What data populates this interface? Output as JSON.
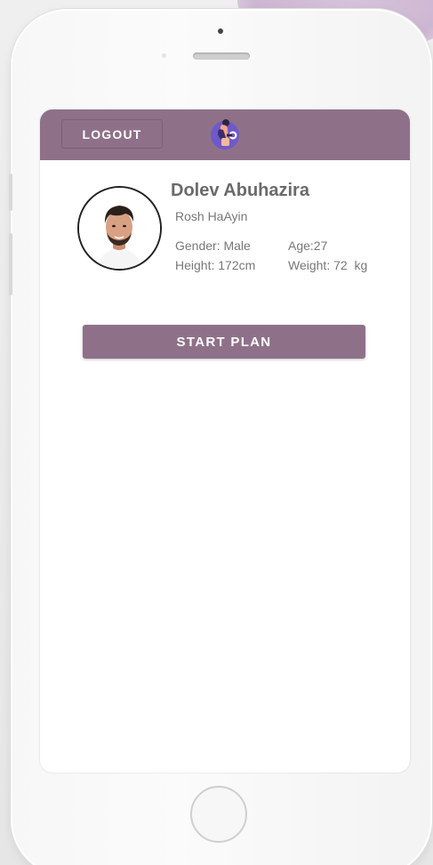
{
  "header": {
    "logout_label": "LOGOUT",
    "logo_icon": "fitness-woman-dumbbell-icon",
    "bar_color": "#8e7189"
  },
  "profile": {
    "name": "Dolev Abuhazira",
    "city": "Rosh HaAyin",
    "gender": "Gender: Male",
    "age": "Age:27",
    "height": "Height: 172cm",
    "weight": "Weight: 72  kg"
  },
  "actions": {
    "start_plan_label": "START PLAN"
  },
  "colors": {
    "accent": "#8e7189",
    "text_muted": "#777777"
  }
}
